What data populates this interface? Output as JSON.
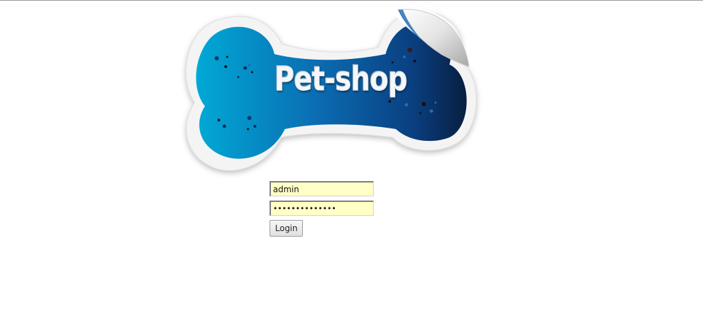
{
  "logo": {
    "text": "Pet-shop",
    "colors": {
      "light_blue": "#00a6d6",
      "mid_blue": "#0f5ea8",
      "dark_blue": "#0b2a52",
      "sticker_white": "#f2f2f2"
    }
  },
  "login": {
    "username_value": "admin",
    "password_mask": "••••••••••••••",
    "button_label": "Login"
  }
}
